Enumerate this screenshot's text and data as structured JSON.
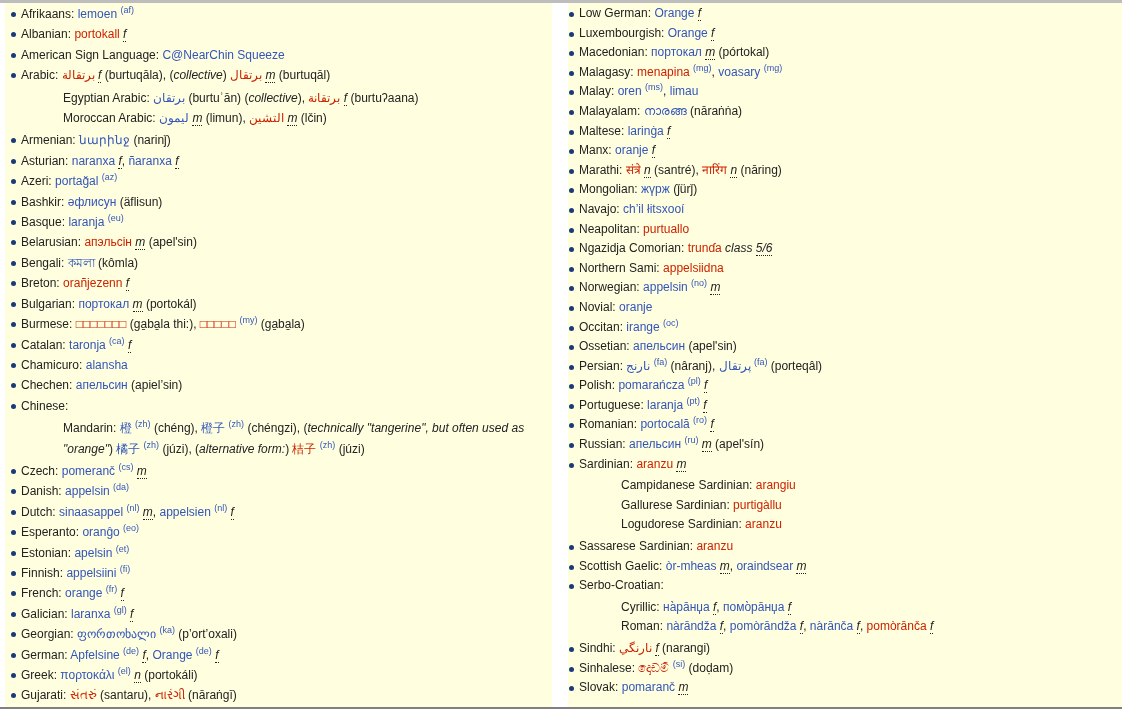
{
  "columns": [
    {
      "entries": [
        {
          "language": "Afrikaans:",
          "parts": [
            {
              "kind": "link",
              "text": "lemoen",
              "missing": false
            },
            {
              "kind": "code",
              "text": "(af)"
            }
          ]
        },
        {
          "language": "Albanian:",
          "parts": [
            {
              "kind": "link",
              "text": "portokall",
              "missing": true
            },
            {
              "kind": "gender",
              "text": "f"
            }
          ]
        },
        {
          "language": "American Sign Language:",
          "parts": [
            {
              "kind": "link",
              "text": "C@NearChin Squeeze",
              "missing": false
            }
          ]
        },
        {
          "language": "Arabic:",
          "parts": [
            {
              "kind": "link",
              "text": "برتقالة",
              "missing": true
            },
            {
              "kind": "gender",
              "text": "f"
            },
            {
              "kind": "text",
              "text": " (burtuqāla), ("
            },
            {
              "kind": "qualifier",
              "text": "collective"
            },
            {
              "kind": "text",
              "text": ") "
            },
            {
              "kind": "link",
              "text": "برتقال",
              "missing": true
            },
            {
              "kind": "gender",
              "text": "m"
            },
            {
              "kind": "text",
              "text": " (burtuqāl)"
            }
          ],
          "children": [
            {
              "language": "Egyptian Arabic:",
              "parts": [
                {
                  "kind": "link",
                  "text": "برتقان",
                  "missing": false
                },
                {
                  "kind": "text",
                  "text": " (burtuʾān) ("
                },
                {
                  "kind": "qualifier",
                  "text": "collective"
                },
                {
                  "kind": "text",
                  "text": "), "
                },
                {
                  "kind": "link",
                  "text": "برتقانة",
                  "missing": true
                },
                {
                  "kind": "gender",
                  "text": "f"
                },
                {
                  "kind": "text",
                  "text": " (burtuʔaana)"
                }
              ]
            },
            {
              "language": "Moroccan Arabic:",
              "parts": [
                {
                  "kind": "link",
                  "text": "ليمون",
                  "missing": false
                },
                {
                  "kind": "gender",
                  "text": "m"
                },
                {
                  "kind": "text",
                  "text": " (limun), "
                },
                {
                  "kind": "link",
                  "text": "التشين",
                  "missing": true
                },
                {
                  "kind": "gender",
                  "text": "m"
                },
                {
                  "kind": "text",
                  "text": " (lčin)"
                }
              ]
            }
          ]
        },
        {
          "language": "Armenian:",
          "parts": [
            {
              "kind": "link",
              "text": "նարինջ",
              "missing": false
            },
            {
              "kind": "text",
              "text": " (narinǰ)"
            }
          ]
        },
        {
          "language": "Asturian:",
          "parts": [
            {
              "kind": "link",
              "text": "naranxa",
              "missing": false
            },
            {
              "kind": "gender",
              "text": "f"
            },
            {
              "kind": "text",
              "text": ", "
            },
            {
              "kind": "link",
              "text": "ñaranxa",
              "missing": false
            },
            {
              "kind": "gender",
              "text": "f"
            }
          ]
        },
        {
          "language": "Azeri:",
          "parts": [
            {
              "kind": "link",
              "text": "portağal",
              "missing": false
            },
            {
              "kind": "code",
              "text": "(az)"
            }
          ]
        },
        {
          "language": "Bashkir:",
          "parts": [
            {
              "kind": "link",
              "text": "әфлисун",
              "missing": false
            },
            {
              "kind": "text",
              "text": " (äflisun)"
            }
          ]
        },
        {
          "language": "Basque:",
          "parts": [
            {
              "kind": "link",
              "text": "laranja",
              "missing": false
            },
            {
              "kind": "code",
              "text": "(eu)"
            }
          ]
        },
        {
          "language": "Belarusian:",
          "parts": [
            {
              "kind": "link",
              "text": "апэльсін",
              "missing": true
            },
            {
              "kind": "gender",
              "text": "m"
            },
            {
              "kind": "text",
              "text": " (apel'sin)"
            }
          ]
        },
        {
          "language": "Bengali:",
          "parts": [
            {
              "kind": "link",
              "text": "কমলা",
              "missing": false
            },
            {
              "kind": "text",
              "text": " (kômla)"
            }
          ]
        },
        {
          "language": "Breton:",
          "parts": [
            {
              "kind": "link",
              "text": "orañjezenn",
              "missing": true
            },
            {
              "kind": "gender",
              "text": "f"
            }
          ]
        },
        {
          "language": "Bulgarian:",
          "parts": [
            {
              "kind": "link",
              "text": "портокал",
              "missing": false
            },
            {
              "kind": "gender",
              "text": "m"
            },
            {
              "kind": "text",
              "text": " (portokál)"
            }
          ]
        },
        {
          "language": "Burmese:",
          "parts": [
            {
              "kind": "link",
              "text": "□□□□□□□",
              "missing": true
            },
            {
              "kind": "text",
              "text": " (ga̱ba̱la thi:), "
            },
            {
              "kind": "link",
              "text": "□□□□□",
              "missing": true
            },
            {
              "kind": "code",
              "text": "(my)"
            },
            {
              "kind": "text",
              "text": " (ga̱ba̱la)"
            }
          ]
        },
        {
          "language": "Catalan:",
          "parts": [
            {
              "kind": "link",
              "text": "taronja",
              "missing": false
            },
            {
              "kind": "code",
              "text": "(ca)"
            },
            {
              "kind": "gender",
              "text": "f"
            }
          ]
        },
        {
          "language": "Chamicuro:",
          "parts": [
            {
              "kind": "link",
              "text": "alansha",
              "missing": false
            }
          ]
        },
        {
          "language": "Chechen:",
          "parts": [
            {
              "kind": "link",
              "text": "апельсин",
              "missing": false
            },
            {
              "kind": "text",
              "text": " (apiel’sin)"
            }
          ]
        },
        {
          "language": "Chinese:",
          "children": [
            {
              "language": "Mandarin:",
              "parts": [
                {
                  "kind": "link",
                  "text": "橙",
                  "missing": false
                },
                {
                  "kind": "code",
                  "text": "(zh)"
                },
                {
                  "kind": "text",
                  "text": " (chéng), "
                },
                {
                  "kind": "link",
                  "text": "橙子",
                  "missing": false
                },
                {
                  "kind": "code",
                  "text": "(zh)"
                },
                {
                  "kind": "text",
                  "text": " (chéngzi), ("
                },
                {
                  "kind": "qualifier",
                  "text": "technically \"tangerine\", but often used as"
                },
                {
                  "kind": "qualifier",
                  "text": "\"orange\""
                },
                {
                  "kind": "text",
                  "text": ") "
                },
                {
                  "kind": "link",
                  "text": "橘子",
                  "missing": false
                },
                {
                  "kind": "code",
                  "text": "(zh)"
                },
                {
                  "kind": "text",
                  "text": " (júzi), ("
                },
                {
                  "kind": "qualifier",
                  "text": "alternative form:"
                },
                {
                  "kind": "text",
                  "text": ") "
                },
                {
                  "kind": "link",
                  "text": "桔子",
                  "missing": true
                },
                {
                  "kind": "code",
                  "text": "(zh)"
                },
                {
                  "kind": "text",
                  "text": " (júzi)"
                }
              ]
            }
          ]
        },
        {
          "language": "Czech:",
          "parts": [
            {
              "kind": "link",
              "text": "pomeranč",
              "missing": false
            },
            {
              "kind": "code",
              "text": "(cs)"
            },
            {
              "kind": "gender",
              "text": "m"
            }
          ]
        },
        {
          "language": "Danish:",
          "parts": [
            {
              "kind": "link",
              "text": "appelsin",
              "missing": false
            },
            {
              "kind": "code",
              "text": "(da)"
            }
          ]
        },
        {
          "language": "Dutch:",
          "parts": [
            {
              "kind": "link",
              "text": "sinaasappel",
              "missing": false
            },
            {
              "kind": "code",
              "text": "(nl)"
            },
            {
              "kind": "gender",
              "text": "m"
            },
            {
              "kind": "text",
              "text": ", "
            },
            {
              "kind": "link",
              "text": "appelsien",
              "missing": false
            },
            {
              "kind": "code",
              "text": "(nl)"
            },
            {
              "kind": "gender",
              "text": "f"
            }
          ]
        },
        {
          "language": "Esperanto:",
          "parts": [
            {
              "kind": "link",
              "text": "oranĝo",
              "missing": false
            },
            {
              "kind": "code",
              "text": "(eo)"
            }
          ]
        },
        {
          "language": "Estonian:",
          "parts": [
            {
              "kind": "link",
              "text": "apelsin",
              "missing": false
            },
            {
              "kind": "code",
              "text": "(et)"
            }
          ]
        },
        {
          "language": "Finnish:",
          "parts": [
            {
              "kind": "link",
              "text": "appelsiini",
              "missing": false
            },
            {
              "kind": "code",
              "text": "(fi)"
            }
          ]
        },
        {
          "language": "French:",
          "parts": [
            {
              "kind": "link",
              "text": "orange",
              "missing": false
            },
            {
              "kind": "code",
              "text": "(fr)"
            },
            {
              "kind": "gender",
              "text": "f"
            }
          ]
        },
        {
          "language": "Galician:",
          "parts": [
            {
              "kind": "link",
              "text": "laranxa",
              "missing": false
            },
            {
              "kind": "code",
              "text": "(gl)"
            },
            {
              "kind": "gender",
              "text": "f"
            }
          ]
        },
        {
          "language": "Georgian:",
          "parts": [
            {
              "kind": "link",
              "text": "ფორთოხალი",
              "missing": false
            },
            {
              "kind": "code",
              "text": "(ka)"
            },
            {
              "kind": "text",
              "text": " (p’ort’oxali)"
            }
          ]
        },
        {
          "language": "German:",
          "parts": [
            {
              "kind": "link",
              "text": "Apfelsine",
              "missing": false
            },
            {
              "kind": "code",
              "text": "(de)"
            },
            {
              "kind": "gender",
              "text": "f"
            },
            {
              "kind": "text",
              "text": ", "
            },
            {
              "kind": "link",
              "text": "Orange",
              "missing": false
            },
            {
              "kind": "code",
              "text": "(de)"
            },
            {
              "kind": "gender",
              "text": "f"
            }
          ]
        },
        {
          "language": "Greek:",
          "parts": [
            {
              "kind": "link",
              "text": "πορτοκάλι",
              "missing": false
            },
            {
              "kind": "code",
              "text": "(el)"
            },
            {
              "kind": "gender",
              "text": "n"
            },
            {
              "kind": "text",
              "text": " (portokáli)"
            }
          ]
        },
        {
          "language": "Gujarati:",
          "parts": [
            {
              "kind": "link",
              "text": "સંતરું",
              "missing": true
            },
            {
              "kind": "text",
              "text": " (santaru), "
            },
            {
              "kind": "link",
              "text": "નારંગી",
              "missing": true
            },
            {
              "kind": "text",
              "text": " (nāraṅgī)"
            }
          ]
        }
      ]
    },
    {
      "entries": [
        {
          "language": "Low German:",
          "parts": [
            {
              "kind": "link",
              "text": "Orange",
              "missing": false
            },
            {
              "kind": "gender",
              "text": "f"
            }
          ]
        },
        {
          "language": "Luxembourgish:",
          "parts": [
            {
              "kind": "link",
              "text": "Orange",
              "missing": false
            },
            {
              "kind": "gender",
              "text": "f"
            }
          ]
        },
        {
          "language": "Macedonian:",
          "parts": [
            {
              "kind": "link",
              "text": "портокал",
              "missing": false
            },
            {
              "kind": "gender",
              "text": "m"
            },
            {
              "kind": "text",
              "text": " (pórtokal)"
            }
          ]
        },
        {
          "language": "Malagasy:",
          "parts": [
            {
              "kind": "link",
              "text": "menapina",
              "missing": true
            },
            {
              "kind": "code",
              "text": "(mg)"
            },
            {
              "kind": "text",
              "text": ", "
            },
            {
              "kind": "link",
              "text": "voasary",
              "missing": false
            },
            {
              "kind": "code",
              "text": "(mg)"
            }
          ]
        },
        {
          "language": "Malay:",
          "parts": [
            {
              "kind": "link",
              "text": "oren",
              "missing": false
            },
            {
              "kind": "code",
              "text": "(ms)"
            },
            {
              "kind": "text",
              "text": ", "
            },
            {
              "kind": "link",
              "text": "limau",
              "missing": false
            }
          ]
        },
        {
          "language": "Malayalam:",
          "parts": [
            {
              "kind": "link",
              "text": "നാരങ്ങ",
              "missing": false
            },
            {
              "kind": "text",
              "text": " (nāraṅṅa)"
            }
          ]
        },
        {
          "language": "Maltese:",
          "parts": [
            {
              "kind": "link",
              "text": "larinġa",
              "missing": false
            },
            {
              "kind": "gender",
              "text": "f"
            }
          ]
        },
        {
          "language": "Manx:",
          "parts": [
            {
              "kind": "link",
              "text": "oranje",
              "missing": false
            },
            {
              "kind": "gender",
              "text": "f"
            }
          ]
        },
        {
          "language": "Marathi:",
          "parts": [
            {
              "kind": "link",
              "text": "संत्रे",
              "missing": true
            },
            {
              "kind": "gender",
              "text": "n"
            },
            {
              "kind": "text",
              "text": " (santré), "
            },
            {
              "kind": "link",
              "text": "नारिंग",
              "missing": true
            },
            {
              "kind": "gender",
              "text": "n"
            },
            {
              "kind": "text",
              "text": " (nāring)"
            }
          ]
        },
        {
          "language": "Mongolian:",
          "parts": [
            {
              "kind": "link",
              "text": "жүрж",
              "missing": false
            },
            {
              "kind": "text",
              "text": " (ǰürǰ)"
            }
          ]
        },
        {
          "language": "Navajo:",
          "parts": [
            {
              "kind": "link",
              "text": "ch’il łitsxooí",
              "missing": false
            }
          ]
        },
        {
          "language": "Neapolitan:",
          "parts": [
            {
              "kind": "link",
              "text": "purtuallo",
              "missing": true
            }
          ]
        },
        {
          "language": "Ngazidja Comorian:",
          "parts": [
            {
              "kind": "link",
              "text": "trunɗa",
              "missing": true
            },
            {
              "kind": "qualifier",
              "text": "class"
            },
            {
              "kind": "gender",
              "text": "5/6"
            }
          ]
        },
        {
          "language": "Northern Sami:",
          "parts": [
            {
              "kind": "link",
              "text": "appelsiidna",
              "missing": true
            }
          ]
        },
        {
          "language": "Norwegian:",
          "parts": [
            {
              "kind": "link",
              "text": "appelsin",
              "missing": false
            },
            {
              "kind": "code",
              "text": "(no)"
            },
            {
              "kind": "gender",
              "text": "m"
            }
          ]
        },
        {
          "language": "Novial:",
          "parts": [
            {
              "kind": "link",
              "text": "oranje",
              "missing": false
            }
          ]
        },
        {
          "language": "Occitan:",
          "parts": [
            {
              "kind": "link",
              "text": "irange",
              "missing": false
            },
            {
              "kind": "code",
              "text": "(oc)"
            }
          ]
        },
        {
          "language": "Ossetian:",
          "parts": [
            {
              "kind": "link",
              "text": "апельсин",
              "missing": false
            },
            {
              "kind": "text",
              "text": " (apel'sin)"
            }
          ]
        },
        {
          "language": "Persian:",
          "parts": [
            {
              "kind": "link",
              "text": "نارنج",
              "missing": false
            },
            {
              "kind": "code",
              "text": "(fa)"
            },
            {
              "kind": "text",
              "text": " (nâranj), "
            },
            {
              "kind": "link",
              "text": "پرتقال",
              "missing": false
            },
            {
              "kind": "code",
              "text": "(fa)"
            },
            {
              "kind": "text",
              "text": " (porteqâl)"
            }
          ]
        },
        {
          "language": "Polish:",
          "parts": [
            {
              "kind": "link",
              "text": "pomarańcza",
              "missing": false
            },
            {
              "kind": "code",
              "text": "(pl)"
            },
            {
              "kind": "gender",
              "text": "f"
            }
          ]
        },
        {
          "language": "Portuguese:",
          "parts": [
            {
              "kind": "link",
              "text": "laranja",
              "missing": false
            },
            {
              "kind": "code",
              "text": "(pt)"
            },
            {
              "kind": "gender",
              "text": "f"
            }
          ]
        },
        {
          "language": "Romanian:",
          "parts": [
            {
              "kind": "link",
              "text": "portocală",
              "missing": false
            },
            {
              "kind": "code",
              "text": "(ro)"
            },
            {
              "kind": "gender",
              "text": "f"
            }
          ]
        },
        {
          "language": "Russian:",
          "parts": [
            {
              "kind": "link",
              "text": "апельсин",
              "missing": false
            },
            {
              "kind": "code",
              "text": "(ru)"
            },
            {
              "kind": "gender",
              "text": "m"
            },
            {
              "kind": "text",
              "text": " (apel'sín)"
            }
          ]
        },
        {
          "language": "Sardinian:",
          "parts": [
            {
              "kind": "link",
              "text": "aranzu",
              "missing": true
            },
            {
              "kind": "gender",
              "text": "m"
            }
          ],
          "children": [
            {
              "language": "Campidanese Sardinian:",
              "parts": [
                {
                  "kind": "link",
                  "text": "arangiu",
                  "missing": true
                }
              ]
            },
            {
              "language": "Gallurese Sardinian:",
              "parts": [
                {
                  "kind": "link",
                  "text": "purtigàllu",
                  "missing": true
                }
              ]
            },
            {
              "language": "Logudorese Sardinian:",
              "parts": [
                {
                  "kind": "link",
                  "text": "aranzu",
                  "missing": true
                }
              ]
            }
          ]
        },
        {
          "language": "Sassarese Sardinian:",
          "parts": [
            {
              "kind": "link",
              "text": "aranzu",
              "missing": true
            }
          ]
        },
        {
          "language": "Scottish Gaelic:",
          "parts": [
            {
              "kind": "link",
              "text": "òr-mheas",
              "missing": false
            },
            {
              "kind": "gender",
              "text": "m"
            },
            {
              "kind": "text",
              "text": ", "
            },
            {
              "kind": "link",
              "text": "oraindsear",
              "missing": false
            },
            {
              "kind": "gender",
              "text": "m"
            }
          ]
        },
        {
          "language": "Serbo-Croatian:",
          "children": [
            {
              "language": "Cyrillic:",
              "parts": [
                {
                  "kind": "link",
                  "text": "на̀ра̄нџа",
                  "missing": false
                },
                {
                  "kind": "gender",
                  "text": "f"
                },
                {
                  "kind": "text",
                  "text": ", "
                },
                {
                  "kind": "link",
                  "text": "помо̀ра̄нџа",
                  "missing": false
                },
                {
                  "kind": "gender",
                  "text": "f"
                }
              ]
            },
            {
              "language": "Roman:",
              "parts": [
                {
                  "kind": "link",
                  "text": "nàrāndža",
                  "missing": false
                },
                {
                  "kind": "gender",
                  "text": "f"
                },
                {
                  "kind": "text",
                  "text": ", "
                },
                {
                  "kind": "link",
                  "text": "pomòrāndža",
                  "missing": false
                },
                {
                  "kind": "gender",
                  "text": "f"
                },
                {
                  "kind": "text",
                  "text": ", "
                },
                {
                  "kind": "link",
                  "text": "nàrānča",
                  "missing": false
                },
                {
                  "kind": "gender",
                  "text": "f"
                },
                {
                  "kind": "text",
                  "text": ", "
                },
                {
                  "kind": "link",
                  "text": "pomòrānča",
                  "missing": true
                },
                {
                  "kind": "gender",
                  "text": "f"
                }
              ]
            }
          ]
        },
        {
          "language": "Sindhi:",
          "parts": [
            {
              "kind": "link",
              "text": "نارنگي",
              "missing": true
            },
            {
              "kind": "gender",
              "text": "f"
            },
            {
              "kind": "text",
              "text": " (narangi)"
            }
          ]
        },
        {
          "language": "Sinhalese:",
          "parts": [
            {
              "kind": "link",
              "text": "දොඩම්",
              "missing": true
            },
            {
              "kind": "code",
              "text": "(si)"
            },
            {
              "kind": "text",
              "text": " (doḍam)"
            }
          ]
        },
        {
          "language": "Slovak:",
          "parts": [
            {
              "kind": "link",
              "text": "pomaranč",
              "missing": false
            },
            {
              "kind": "gender",
              "text": "m"
            }
          ]
        }
      ]
    }
  ]
}
